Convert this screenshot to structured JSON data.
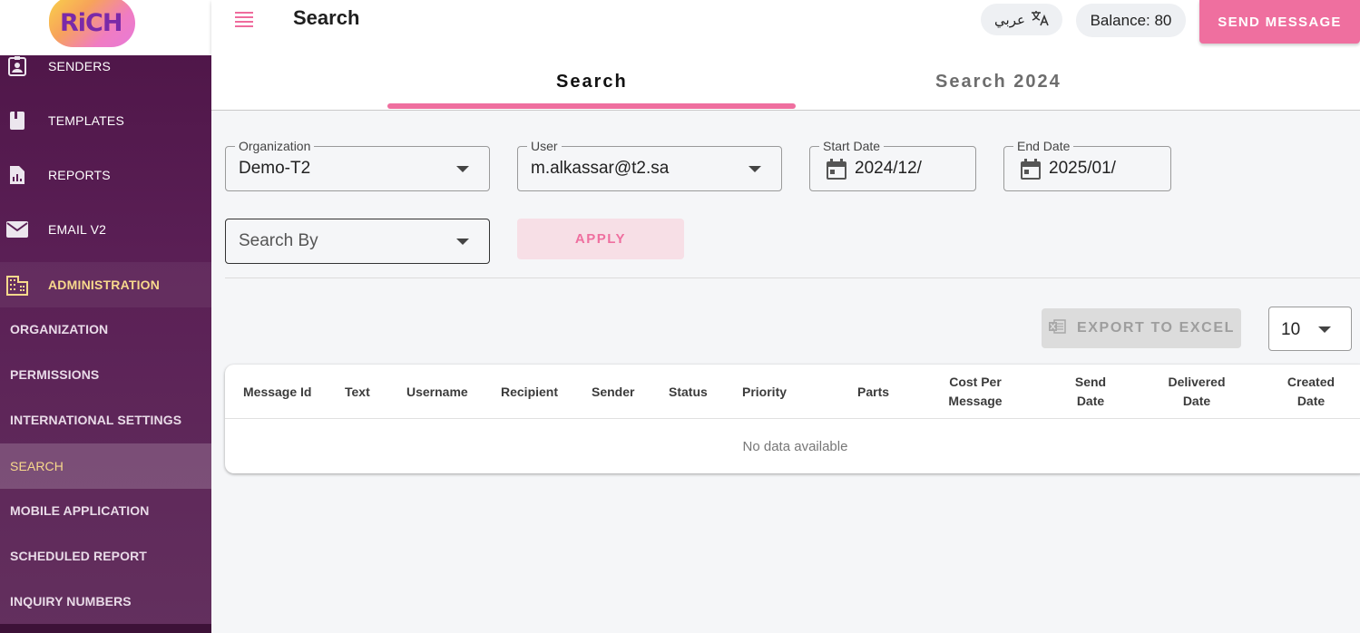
{
  "brand": {
    "logo_text": "RiCH"
  },
  "sidebar": {
    "main_items": [
      {
        "label": "SENDERS",
        "icon": "contact-badge-icon"
      },
      {
        "label": "TEMPLATES",
        "icon": "book-icon"
      },
      {
        "label": "REPORTS",
        "icon": "report-chart-icon"
      },
      {
        "label": "EMAIL V2",
        "icon": "mail-icon"
      },
      {
        "label": "ADMINISTRATION",
        "icon": "building-icon"
      }
    ],
    "sub_items": [
      {
        "label": "ORGANIZATION"
      },
      {
        "label": "PERMISSIONS"
      },
      {
        "label": "INTERNATIONAL SETTINGS"
      },
      {
        "label": "SEARCH",
        "active": true
      },
      {
        "label": "MOBILE APPLICATION"
      },
      {
        "label": "SCHEDULED REPORT"
      },
      {
        "label": "INQUIRY NUMBERS"
      }
    ]
  },
  "topbar": {
    "title": "Search",
    "language_label": "عربي",
    "balance_label": "Balance: 80",
    "send_button": "SEND MESSAGE"
  },
  "tabs": [
    {
      "label": "Search",
      "active": true
    },
    {
      "label": "Search 2024",
      "active": false
    }
  ],
  "filters": {
    "organization": {
      "label": "Organization",
      "value": "Demo-T2"
    },
    "user": {
      "label": "User",
      "value": "m.alkassar@t2.sa"
    },
    "start_date": {
      "label": "Start Date",
      "value": "2024/12/"
    },
    "end_date": {
      "label": "End Date",
      "value": "2025/01/"
    },
    "search_by": {
      "placeholder": "Search By"
    },
    "apply_button": "APPLY"
  },
  "export_button": "EXPORT TO EXCEL",
  "per_page": "10",
  "table": {
    "columns": [
      "Message Id",
      "Text",
      "Username",
      "Recipient",
      "Sender",
      "Status",
      "Priority",
      "Parts",
      "Cost Per Message",
      "Send Date",
      "Delivered Date",
      "Created Date"
    ],
    "empty_text": "No data available"
  },
  "colors": {
    "accent": "#ef6f9f",
    "sidebar_bg": "#4d1446",
    "active_label": "#f8d98c"
  }
}
